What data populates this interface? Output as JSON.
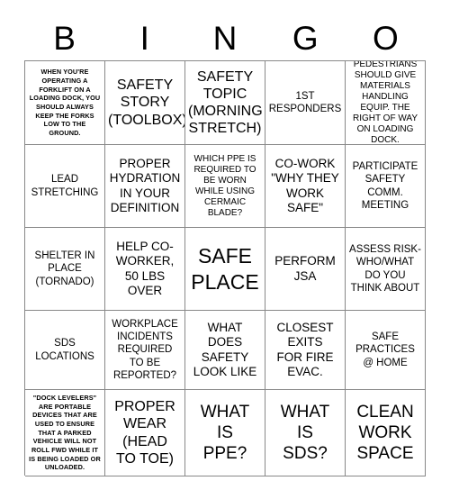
{
  "header": {
    "letters": [
      "B",
      "I",
      "N",
      "G",
      "O"
    ]
  },
  "grid": {
    "rows": [
      [
        {
          "text": "WHEN YOU'RE OPERATING A FORKLIFT ON A LOADING DOCK, YOU SHOULD ALWAYS KEEP THE FORKS LOW TO THE GROUND.",
          "size": "xs"
        },
        {
          "text": "SAFETY\nSTORY\n(TOOLBOX)",
          "size": "xl"
        },
        {
          "text": "SAFETY\nTOPIC\n(MORNING\nSTRETCH)",
          "size": "xl"
        },
        {
          "text": "1ST\nRESPONDERS",
          "size": "m"
        },
        {
          "text": "PEDESTRIANS SHOULD GIVE MATERIALS HANDLING EQUIP. THE RIGHT OF WAY ON LOADING DOCK.",
          "size": "s"
        }
      ],
      [
        {
          "text": "LEAD\nSTRETCHING",
          "size": "m"
        },
        {
          "text": "PROPER\nHYDRATION\nIN YOUR\nDEFINITION",
          "size": "l"
        },
        {
          "text": "WHICH PPE IS REQUIRED TO BE WORN WHILE USING CERMAIC BLADE?",
          "size": "s"
        },
        {
          "text": "CO-WORK\n\"WHY THEY\nWORK\nSAFE\"",
          "size": "l"
        },
        {
          "text": "PARTICIPATE\nSAFETY\nCOMM.\nMEETING",
          "size": "m"
        }
      ],
      [
        {
          "text": "SHELTER IN\nPLACE\n(TORNADO)",
          "size": "m"
        },
        {
          "text": "HELP CO-\nWORKER,\n50 LBS\nOVER",
          "size": "l"
        },
        {
          "text": "SAFE\nPLACE",
          "size": "huge"
        },
        {
          "text": "PERFORM\nJSA",
          "size": "l"
        },
        {
          "text": "ASSESS RISK-WHO/WHAT DO YOU THINK ABOUT",
          "size": "m"
        }
      ],
      [
        {
          "text": "SDS\nLOCATIONS",
          "size": "m"
        },
        {
          "text": "WORKPLACE\nINCIDENTS\nREQUIRED\nTO BE\nREPORTED?",
          "size": "m"
        },
        {
          "text": "WHAT\nDOES\nSAFETY\nLOOK LIKE",
          "size": "l"
        },
        {
          "text": "CLOSEST\nEXITS\nFOR FIRE\nEVAC.",
          "size": "l"
        },
        {
          "text": "SAFE\nPRACTICES\n@ HOME",
          "size": "m"
        }
      ],
      [
        {
          "text": "\"DOCK LEVELERS\" ARE PORTABLE DEVICES THAT ARE USED TO ENSURE THAT A PARKED VEHICLE WILL NOT ROLL FWD WHILE IT IS BEING LOADED OR UNLOADED.",
          "size": "xs"
        },
        {
          "text": "PROPER\nWEAR\n(HEAD\nTO TOE)",
          "size": "xl"
        },
        {
          "text": "WHAT\nIS\nPPE?",
          "size": "xxl"
        },
        {
          "text": "WHAT\nIS\nSDS?",
          "size": "xxl"
        },
        {
          "text": "CLEAN\nWORK\nSPACE",
          "size": "xxl"
        }
      ]
    ]
  },
  "colors": {
    "background": "#ffffff",
    "text": "#000000",
    "border": "#888888"
  }
}
